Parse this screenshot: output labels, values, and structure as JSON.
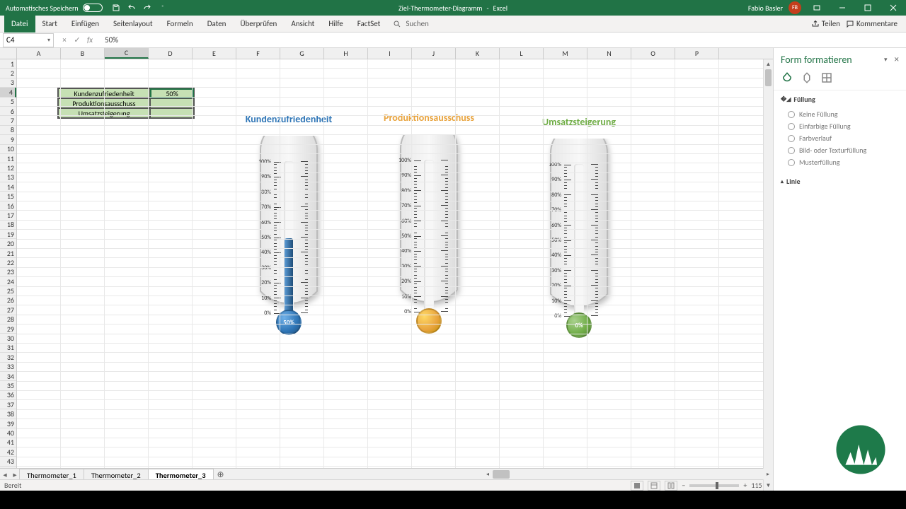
{
  "title_bar": {
    "auto_save": "Automatisches Speichern",
    "doc_title": "Ziel-Thermometer-Diagramm",
    "app_name": "Excel",
    "user_name": "Fabio Basler",
    "user_initials": "FB"
  },
  "ribbon": {
    "tabs": [
      "Datei",
      "Start",
      "Einfügen",
      "Seitenlayout",
      "Formeln",
      "Daten",
      "Überprüfen",
      "Ansicht",
      "Hilfe",
      "FactSet"
    ],
    "search": "Suchen",
    "share": "Teilen",
    "comments": "Kommentare"
  },
  "formula_bar": {
    "cell_ref": "C4",
    "value": "50%"
  },
  "columns": [
    "A",
    "B",
    "C",
    "D",
    "E",
    "F",
    "G",
    "H",
    "I",
    "J",
    "K",
    "L",
    "M",
    "N",
    "O",
    "P"
  ],
  "row_count": 43,
  "selected_col": "C",
  "selected_row": 4,
  "data_table": {
    "rows": [
      {
        "label": "Kundenzufriedenheit",
        "value": "50%"
      },
      {
        "label": "Produktionsausschuss",
        "value": ""
      },
      {
        "label": "Umsatzsteigerung",
        "value": ""
      }
    ]
  },
  "thermometers": [
    {
      "title": "Kundenzufriedenheit",
      "value_pct": 50,
      "value_label": "50%",
      "color": "#2e75b6"
    },
    {
      "title": "Produktionsausschuss",
      "value_pct": 0,
      "value_label": "",
      "color": "#e8a33d"
    },
    {
      "title": "Umsatzsteigerung",
      "value_pct": 0,
      "value_label": "0%",
      "color": "#70ad47"
    }
  ],
  "tick_labels": [
    "100%",
    "90%",
    "80%",
    "70%",
    "60%",
    "50%",
    "40%",
    "30%",
    "20%",
    "10%",
    "0%"
  ],
  "side_pane": {
    "title": "Form formatieren",
    "section_fill": "Füllung",
    "options": [
      "Keine Füllung",
      "Einfarbige Füllung",
      "Farbverlauf",
      "Bild- oder Texturfüllung",
      "Musterfüllung"
    ],
    "section_line": "Linie"
  },
  "sheet_tabs": {
    "tabs": [
      "Thermometer_1",
      "Thermometer_2",
      "Thermometer_3"
    ],
    "active_index": 2
  },
  "status": {
    "ready": "Bereit",
    "zoom": "115 %"
  },
  "chart_data": [
    {
      "type": "bar",
      "title": "Kundenzufriedenheit",
      "categories": [
        "Kundenzufriedenheit"
      ],
      "values": [
        50
      ],
      "ylim": [
        0,
        100
      ],
      "ylabel": "%"
    },
    {
      "type": "bar",
      "title": "Produktionsausschuss",
      "categories": [
        "Produktionsausschuss"
      ],
      "values": [
        0
      ],
      "ylim": [
        0,
        100
      ],
      "ylabel": "%"
    },
    {
      "type": "bar",
      "title": "Umsatzsteigerung",
      "categories": [
        "Umsatzsteigerung"
      ],
      "values": [
        0
      ],
      "ylim": [
        0,
        100
      ],
      "ylabel": "%"
    }
  ]
}
